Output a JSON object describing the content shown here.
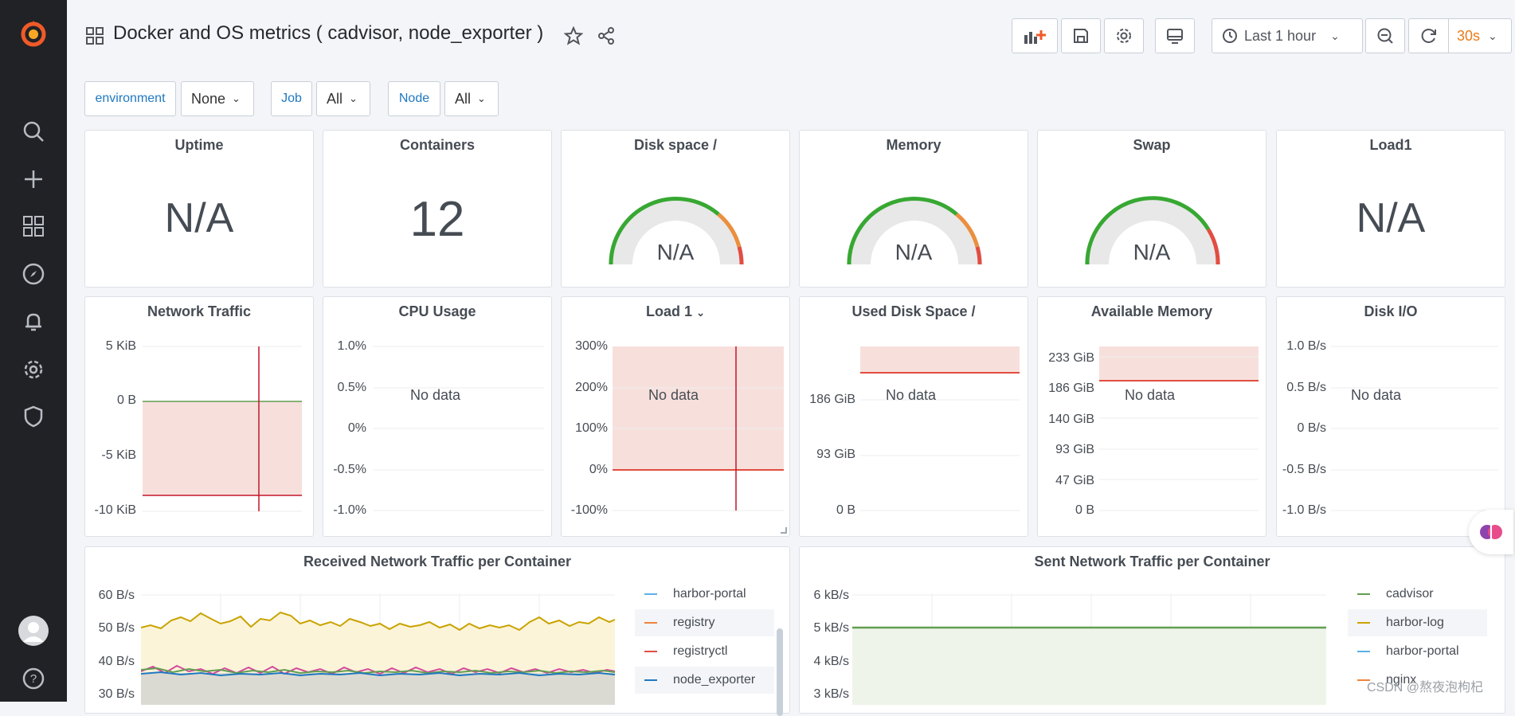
{
  "sidebar": {
    "items": [
      {
        "icon": "grafana-logo-icon"
      },
      {
        "icon": "search-icon"
      },
      {
        "icon": "plus-icon"
      },
      {
        "icon": "dashboards-icon"
      },
      {
        "icon": "explore-compass-icon"
      },
      {
        "icon": "alerting-bell-icon"
      },
      {
        "icon": "configuration-gear-icon"
      },
      {
        "icon": "server-admin-shield-icon"
      },
      {
        "icon": "user-avatar-icon"
      },
      {
        "icon": "help-icon"
      }
    ]
  },
  "header": {
    "title": "Docker and OS metrics ( cadvisor, node_exporter )",
    "time_range": "Last 1 hour",
    "refresh": "30s"
  },
  "variables": [
    {
      "label": "environment",
      "value": "None"
    },
    {
      "label": "Job",
      "value": "All"
    },
    {
      "label": "Node",
      "value": "All"
    }
  ],
  "stats": {
    "uptime": {
      "title": "Uptime",
      "value": "N/A"
    },
    "containers": {
      "title": "Containers",
      "value": "12"
    },
    "disk": {
      "title": "Disk space /",
      "value": "N/A"
    },
    "memory": {
      "title": "Memory",
      "value": "N/A"
    },
    "swap": {
      "title": "Swap",
      "value": "N/A"
    },
    "load1": {
      "title": "Load1",
      "value": "N/A"
    }
  },
  "graphs": {
    "network": {
      "title": "Network Traffic",
      "ticks": [
        "5 KiB",
        "0 B",
        "-5 KiB",
        "-10 KiB"
      ]
    },
    "cpu": {
      "title": "CPU Usage",
      "ticks": [
        "1.0%",
        "0.5%",
        "0%",
        "-0.5%",
        "-1.0%"
      ],
      "nodata": "No data"
    },
    "load": {
      "title": "Load 1",
      "ticks": [
        "300%",
        "200%",
        "100%",
        "0%",
        "-100%"
      ],
      "nodata": "No data"
    },
    "disk": {
      "title": "Used Disk Space /",
      "ticks": [
        "186 GiB",
        "93 GiB",
        "0 B"
      ],
      "nodata": "No data"
    },
    "mem": {
      "title": "Available Memory",
      "ticks": [
        "233 GiB",
        "186 GiB",
        "140 GiB",
        "93 GiB",
        "47 GiB",
        "0 B"
      ],
      "nodata": "No data"
    },
    "diskio": {
      "title": "Disk I/O",
      "ticks": [
        "1.0 B/s",
        "0.5 B/s",
        "0 B/s",
        "-0.5 B/s",
        "-1.0 B/s"
      ],
      "nodata": "No data"
    }
  },
  "received": {
    "title": "Received Network Traffic per Container",
    "ticks": [
      "60 B/s",
      "50 B/s",
      "40 B/s",
      "30 B/s"
    ],
    "legend": [
      {
        "name": "harbor-portal",
        "color": "#5ab0e4"
      },
      {
        "name": "registry",
        "color": "#ef843c"
      },
      {
        "name": "registryctl",
        "color": "#e24d42"
      },
      {
        "name": "node_exporter",
        "color": "#1f78c1"
      }
    ]
  },
  "sent": {
    "title": "Sent Network Traffic per Container",
    "ticks": [
      "6 kB/s",
      "5 kB/s",
      "4 kB/s",
      "3 kB/s"
    ],
    "legend": [
      {
        "name": "cadvisor",
        "color": "#629e51"
      },
      {
        "name": "harbor-log",
        "color": "#cca300"
      },
      {
        "name": "harbor-portal",
        "color": "#5ab0e4"
      },
      {
        "name": "nginx",
        "color": "#ef843c"
      }
    ]
  },
  "watermark": "CSDN @熬夜泡枸杞"
}
